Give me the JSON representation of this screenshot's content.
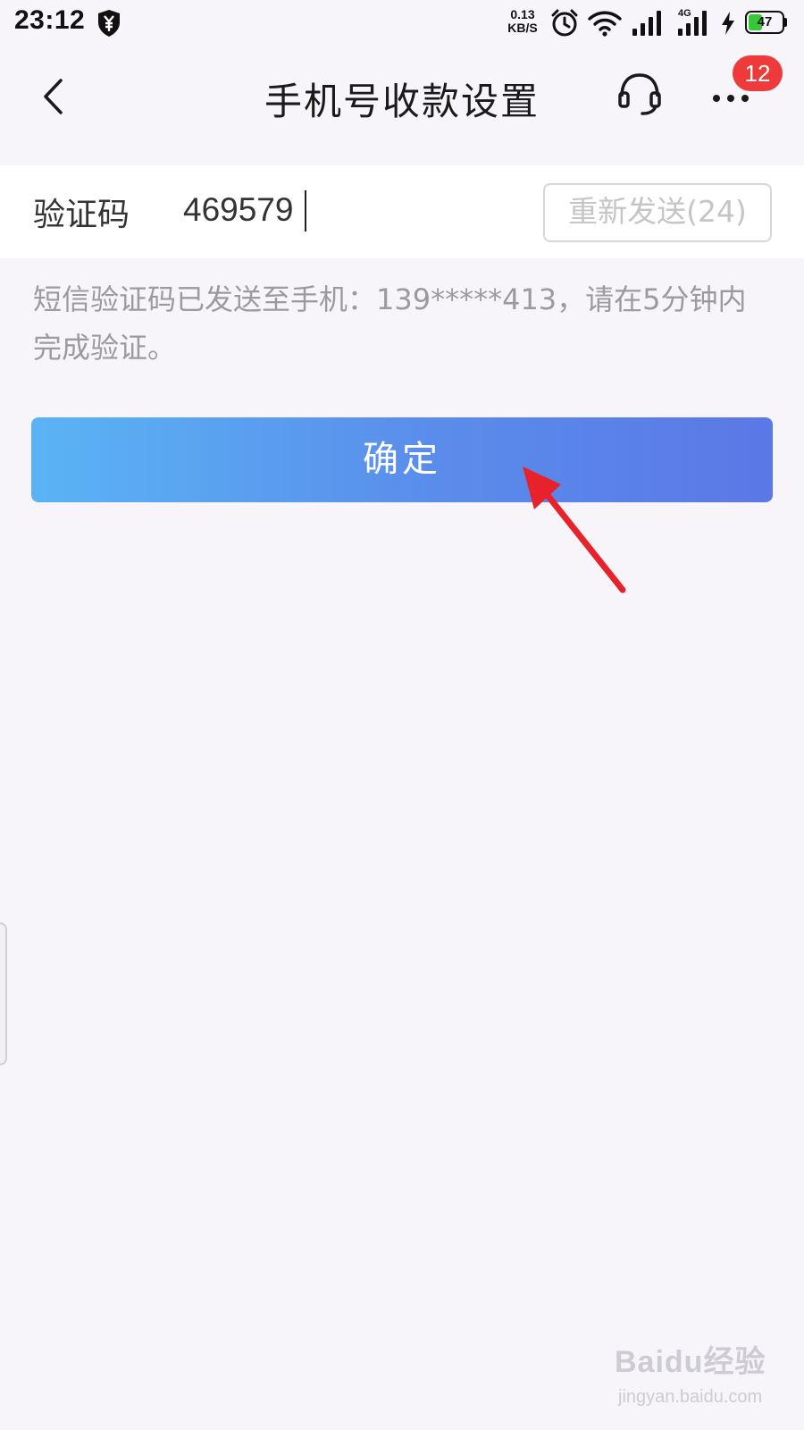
{
  "status_bar": {
    "time": "23:12",
    "net_speed_value": "0.13",
    "net_speed_unit": "KB/S",
    "network_type": "4G",
    "battery_level": 47,
    "battery_text": "47",
    "battery_color": "#37c737",
    "icons": [
      "shield-yen-icon",
      "alarm-icon",
      "wifi-icon",
      "signal-icon",
      "signal-4g-icon",
      "charging-icon",
      "battery-icon"
    ]
  },
  "nav": {
    "title": "手机号收款设置",
    "back_icon": "chevron-left-icon",
    "service_icon": "headset-icon",
    "more_icon": "more-dots-icon",
    "badge_count": "12",
    "badge_color": "#ee3a3a"
  },
  "form": {
    "code_label": "验证码",
    "code_value": "469579",
    "resend_label": "重新发送(24)"
  },
  "hint": {
    "text": "短信验证码已发送至手机：139*****413，请在5分钟内完成验证。"
  },
  "confirm": {
    "label": "确定",
    "gradient_start": "#5ab4f4",
    "gradient_end": "#5b78e6"
  },
  "annotation": {
    "arrow_color": "#e8222a"
  },
  "watermark": {
    "logo_text": "Baidu经验",
    "url": "jingyan.baidu.com"
  }
}
